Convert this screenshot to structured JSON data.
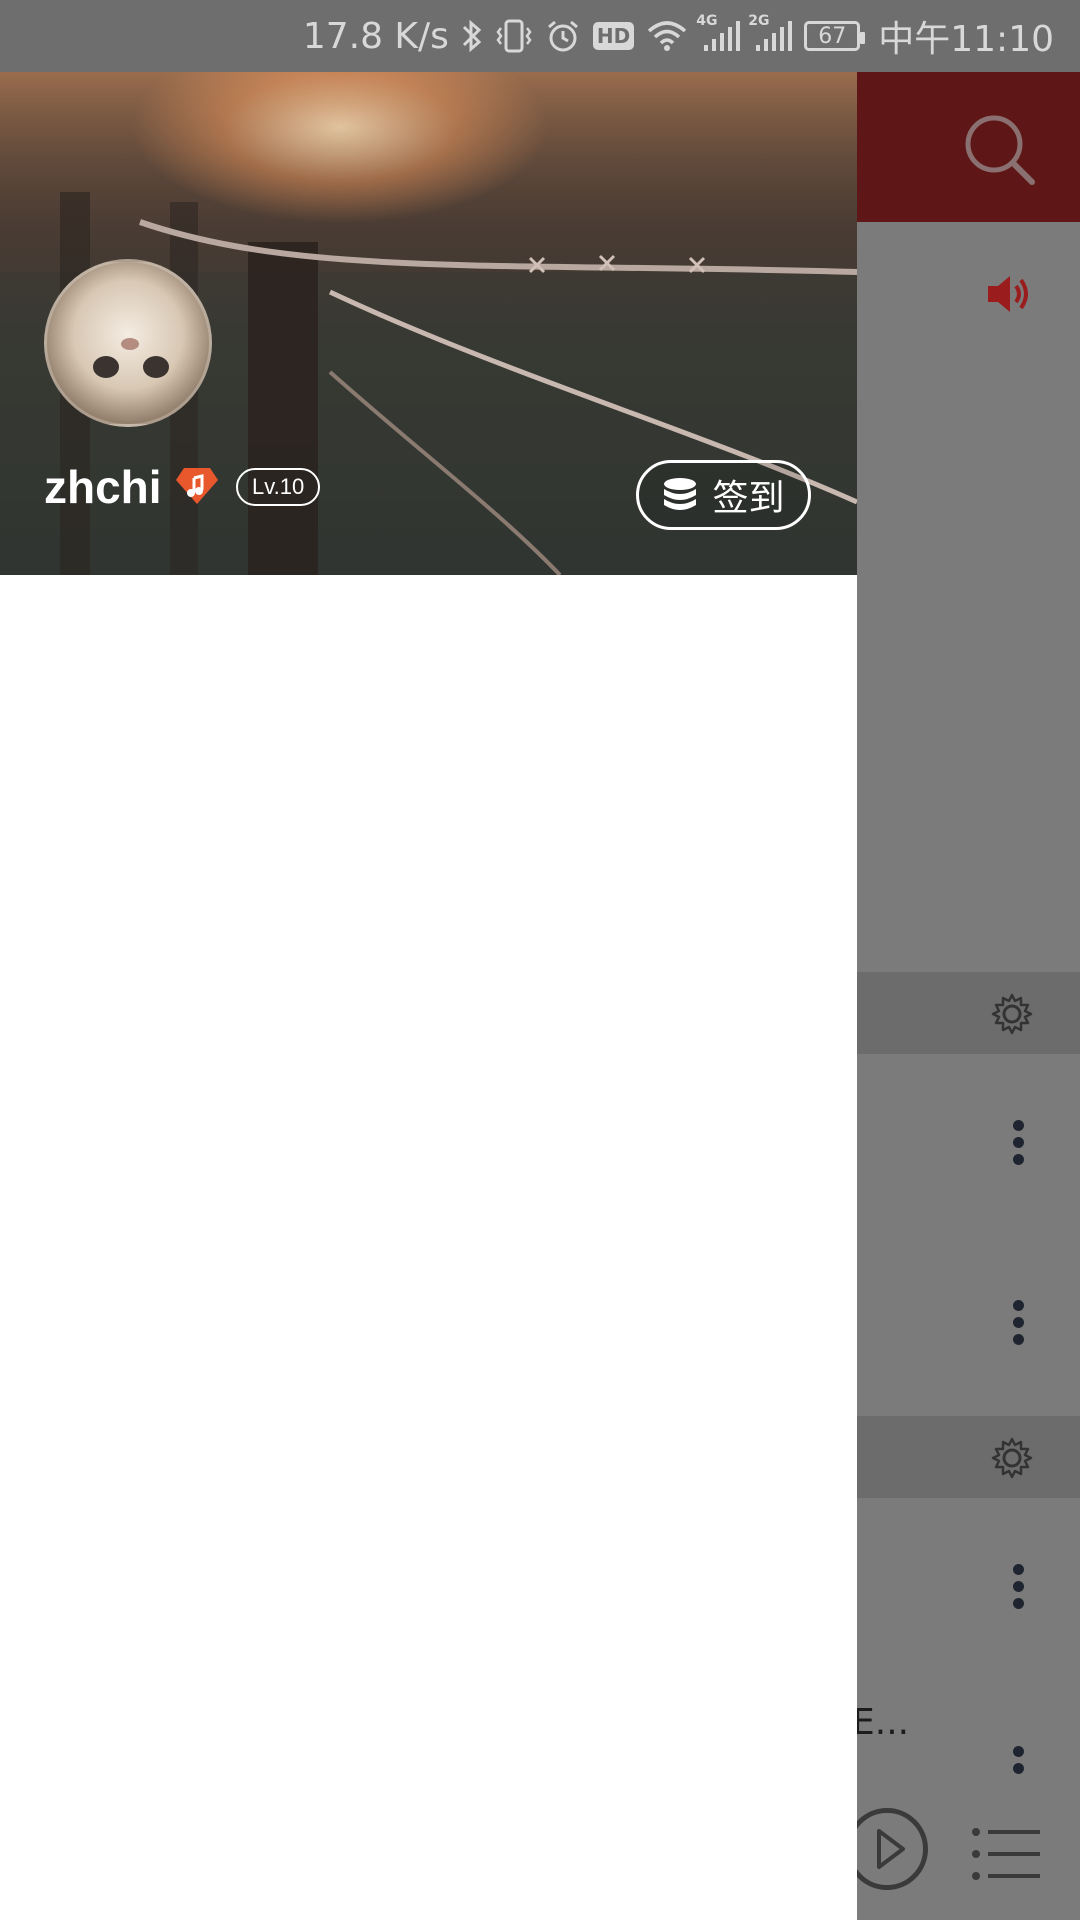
{
  "status_bar": {
    "net_speed": "17.8 K/s",
    "hd": "HD",
    "net_4g": "4G",
    "net_2g": "2G",
    "battery": "67",
    "time": "中午11:10"
  },
  "drawer": {
    "username": "zhchi",
    "level": "Lv.10",
    "signin_label": "签到"
  },
  "background": {
    "truncated_text": "E..."
  },
  "colors": {
    "header_red": "#5e1616",
    "vip_orange": "#e8582c",
    "speaker_red": "#9a1c1c"
  },
  "icons": [
    "bluetooth-icon",
    "vibrate-icon",
    "alarm-icon",
    "wifi-icon",
    "signal-icon",
    "search-icon",
    "speaker-icon",
    "gear-icon",
    "more-vert-icon",
    "play-icon",
    "playlist-icon",
    "coin-icon",
    "vip-badge-icon"
  ]
}
